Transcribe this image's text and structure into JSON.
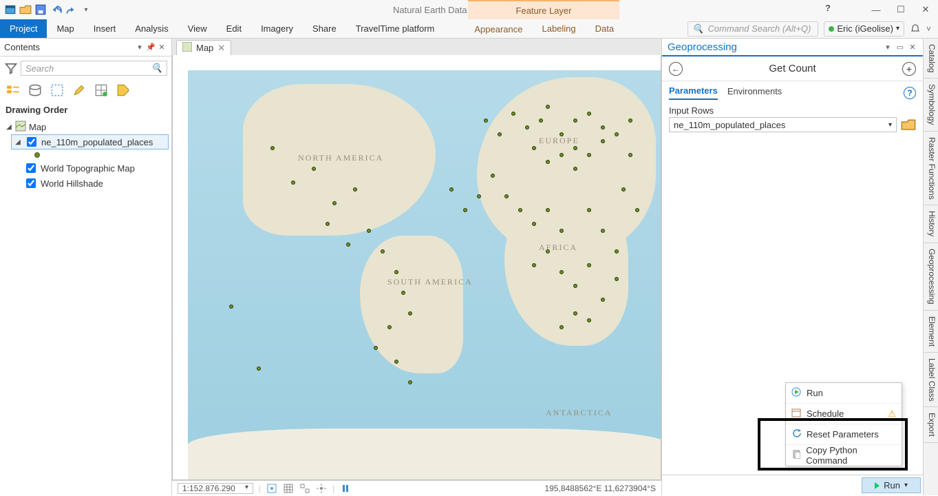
{
  "app": {
    "title": "Natural Earth Data - Map - ArcGIS Pro",
    "context_tab": "Feature Layer",
    "command_search_placeholder": "Command Search (Alt+Q)",
    "user": "Eric (iGeolise)"
  },
  "ribbon": {
    "tabs": [
      "Project",
      "Map",
      "Insert",
      "Analysis",
      "View",
      "Edit",
      "Imagery",
      "Share",
      "TravelTime platform"
    ],
    "context_tabs": [
      "Appearance",
      "Labeling",
      "Data"
    ]
  },
  "contents_panel": {
    "title": "Contents",
    "search_placeholder": "Search",
    "section": "Drawing Order",
    "layers": {
      "root": "Map",
      "l1": "ne_110m_populated_places",
      "l2": "World Topographic Map",
      "l3": "World Hillshade"
    }
  },
  "map_tab": {
    "label": "Map"
  },
  "map_labels": {
    "na": "NORTH AMERICA",
    "sa": "SOUTH AMERICA",
    "eu": "EUROPE",
    "af": "AFRICA",
    "an": "ANTARCTICA"
  },
  "status": {
    "scale": "1:152.876.290",
    "coords": "195,8488562°E 11,6273904°S"
  },
  "gp": {
    "title": "Geoprocessing",
    "tool": "Get Count",
    "tab_params": "Parameters",
    "tab_env": "Environments",
    "param_label": "Input Rows",
    "param_value": "ne_110m_populated_places",
    "run": "Run"
  },
  "ctxmenu": {
    "run": "Run",
    "schedule": "Schedule",
    "reset": "Reset Parameters",
    "copy": "Copy Python Command"
  },
  "side_tabs": [
    "Catalog",
    "Symbology",
    "Raster Functions",
    "History",
    "Geoprocessing",
    "Element",
    "Label Class",
    "Export"
  ]
}
